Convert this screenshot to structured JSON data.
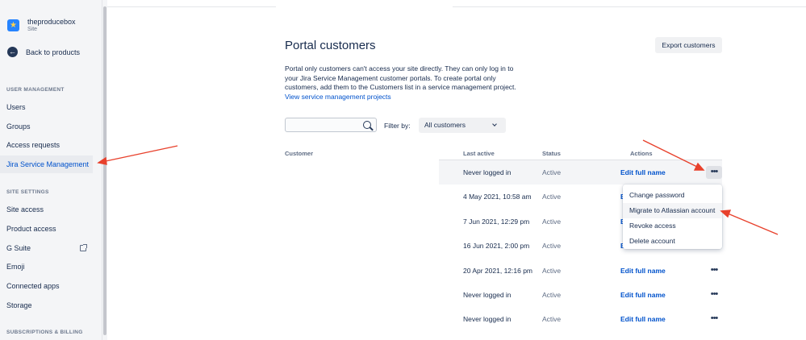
{
  "sidebar": {
    "site_name": "theproducebox",
    "site_type": "Site",
    "back_label": "Back to products",
    "sections": {
      "user_management": "USER MANAGEMENT",
      "site_settings": "SITE SETTINGS",
      "subscriptions": "SUBSCRIPTIONS & BILLING"
    },
    "user_items": [
      "Users",
      "Groups",
      "Access requests",
      "Jira Service Management"
    ],
    "site_items": [
      "Site access",
      "Product access",
      "G Suite",
      "Emoji",
      "Connected apps",
      "Storage"
    ],
    "active_item": "Jira Service Management"
  },
  "main": {
    "title": "Portal customers",
    "export_label": "Export customers",
    "description": "Portal only customers can't access your site directly. They can only log in to your Jira Service Management customer portals. To create portal only customers, add them to the Customers list in a service management project.",
    "link": "View service management projects",
    "search": {
      "value": "",
      "placeholder": ""
    },
    "filter_label": "Filter by:",
    "filter_value": "All customers"
  },
  "table": {
    "headers": {
      "customer": "Customer",
      "last_active": "Last active",
      "status": "Status",
      "actions": "Actions"
    },
    "rows": [
      {
        "last_active": "Never logged in",
        "status": "Active",
        "action": "Edit full name"
      },
      {
        "last_active": "4 May 2021, 10:58 am",
        "status": "Active",
        "action": "E"
      },
      {
        "last_active": "7 Jun 2021, 12:29 pm",
        "status": "Active",
        "action": "E"
      },
      {
        "last_active": "16 Jun 2021, 2:00 pm",
        "status": "Active",
        "action": "E"
      },
      {
        "last_active": "20 Apr 2021, 12:16 pm",
        "status": "Active",
        "action": "Edit full name"
      },
      {
        "last_active": "Never logged in",
        "status": "Active",
        "action": "Edit full name"
      },
      {
        "last_active": "Never logged in",
        "status": "Active",
        "action": "Edit full name"
      }
    ],
    "more_glyph": "•••"
  },
  "menu": {
    "items": [
      "Change password",
      "Migrate to Atlassian account",
      "Revoke access",
      "Delete account"
    ]
  },
  "colors": {
    "accent": "#0052cc",
    "annotation": "#e8412c",
    "sidebar_bg": "#f4f5f7"
  },
  "icons": {
    "site_logo": "star-logo-icon",
    "back": "arrow-left-icon",
    "external": "external-link-icon",
    "search": "search-icon",
    "chevron": "chevron-down-icon",
    "more": "more-icon"
  }
}
